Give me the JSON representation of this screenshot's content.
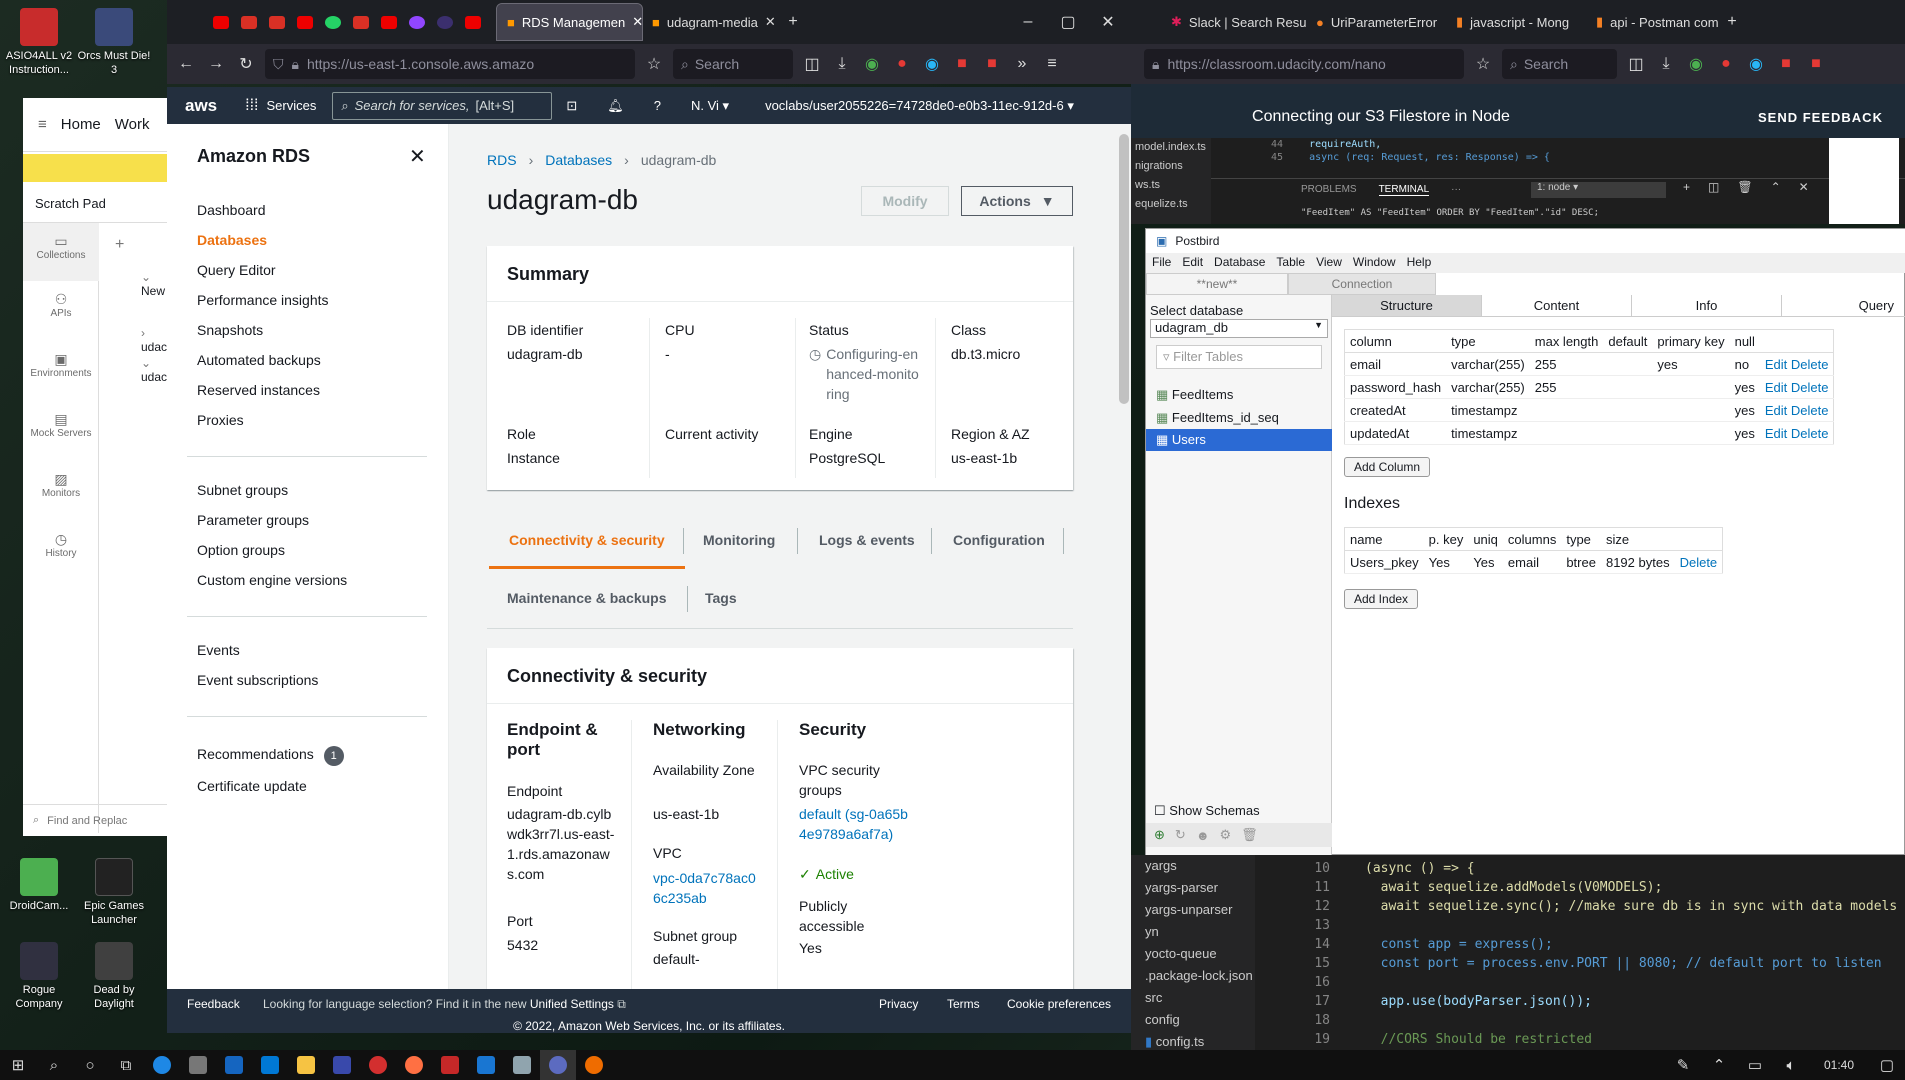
{
  "desktop": {
    "icons": [
      {
        "label": "ASIO4ALL v2 Instruction...",
        "color": "#c82c2c"
      },
      {
        "label": "Orcs Must Die! 3",
        "color": "#3a4a7a"
      },
      {
        "label": "DroidCam...",
        "color": "#4caf50"
      },
      {
        "label": "Epic Games Launcher",
        "color": "#222222"
      },
      {
        "label": "Rogue Company",
        "color": "#303040"
      },
      {
        "label": "Dead by Daylight",
        "color": "#404040"
      }
    ]
  },
  "browser_left": {
    "tabs": [
      {
        "label": "RDS Managemen",
        "active": true
      },
      {
        "label": "udagram-media",
        "active": false
      }
    ],
    "url": "https://us-east-1.console.aws.amazo",
    "search_placeholder": "Search"
  },
  "browser_right": {
    "tabs": [
      {
        "label": "Slack | Search Resu"
      },
      {
        "label": "UriParameterError"
      },
      {
        "label": "javascript - Mong"
      },
      {
        "label": "api - Postman com"
      }
    ],
    "url": "https://classroom.udacity.com/nano",
    "search_placeholder": "Search"
  },
  "aws": {
    "logo": "aws",
    "services": "Services",
    "search_placeholder": "Search for services,",
    "search_shortcut": "[Alt+S]",
    "region": "N. Vi",
    "account": "voclabs/user2055226=74728de0-e0b3-11ec-912d-6"
  },
  "rds_sidebar": {
    "title": "Amazon RDS",
    "items": [
      "Dashboard",
      "Databases",
      "Query Editor",
      "Performance insights",
      "Snapshots",
      "Automated backups",
      "Reserved instances",
      "Proxies"
    ],
    "items2": [
      "Subnet groups",
      "Parameter groups",
      "Option groups",
      "Custom engine versions"
    ],
    "items3": [
      "Events",
      "Event subscriptions"
    ],
    "items4": [
      "Recommendations",
      "Certificate update"
    ],
    "recommendations_badge": "1"
  },
  "rds_main": {
    "breadcrumb": [
      "RDS",
      "Databases",
      "udagram-db"
    ],
    "title": "udagram-db",
    "modify": "Modify",
    "actions": "Actions",
    "summary": {
      "heading": "Summary",
      "db_identifier_label": "DB identifier",
      "db_identifier": "udagram-db",
      "cpu_label": "CPU",
      "cpu": "-",
      "status_label": "Status",
      "status": "Configuring-enhanced-monitoring",
      "class_label": "Class",
      "class": "db.t3.micro",
      "role_label": "Role",
      "role": "Instance",
      "activity_label": "Current activity",
      "engine_label": "Engine",
      "engine": "PostgreSQL",
      "region_label": "Region & AZ",
      "region": "us-east-1b"
    },
    "tabs": [
      "Connectivity & security",
      "Monitoring",
      "Logs & events",
      "Configuration",
      "Maintenance & backups",
      "Tags"
    ],
    "conn": {
      "heading": "Connectivity & security",
      "endpoint_heading": "Endpoint & port",
      "endpoint_label": "Endpoint",
      "endpoint": "udagram-db.cylbwdk3rr7l.us-east-1.rds.amazonaws.com",
      "port_label": "Port",
      "port": "5432",
      "networking_heading": "Networking",
      "az_label": "Availability Zone",
      "az": "us-east-1b",
      "vpc_label": "VPC",
      "vpc": "vpc-0da7c78ac06c235ab",
      "subnet_label": "Subnet group",
      "subnet": "default-",
      "security_heading": "Security",
      "sg_label": "VPC security groups",
      "sg": "default (sg-0a65b4e9789a6af7a)",
      "sg_status": "Active",
      "public_label": "Publicly accessible",
      "public": "Yes"
    }
  },
  "aws_footer": {
    "feedback": "Feedback",
    "lang_msg": "Looking for language selection? Find it in the new",
    "unified": "Unified Settings",
    "privacy": "Privacy",
    "terms": "Terms",
    "cookies": "Cookie preferences",
    "copyright": "© 2022, Amazon Web Services, Inc. or its affiliates."
  },
  "udacity": {
    "header": "Connecting our S3 Filestore in Node",
    "feedback": "SEND FEEDBACK"
  },
  "vscode_top": {
    "files": [
      "model.index.ts",
      "nigrations",
      "ws.ts",
      "equelize.ts"
    ],
    "lines": [
      {
        "n": "44",
        "t": "requireAuth,"
      },
      {
        "n": "45",
        "t": "async (req: Request, res: Response) => {"
      }
    ],
    "panel_tabs": [
      "PROBLEMS",
      "TERMINAL",
      "···"
    ],
    "terminal_select": "1: node",
    "terminal_text": "\"FeedItem\" AS \"FeedItem\" ORDER BY \"FeedItem\".\"id\" DESC;"
  },
  "postbird": {
    "title": "Postbird",
    "menu": [
      "File",
      "Edit",
      "Database",
      "Table",
      "View",
      "Window",
      "Help"
    ],
    "tabs": [
      "**new**",
      "Connection"
    ],
    "subtabs": [
      "Structure",
      "Content",
      "Info",
      "Query"
    ],
    "select_db_label": "Select database",
    "db": "udagram_db",
    "filter_placeholder": "Filter Tables",
    "tables": [
      "FeedItems",
      "FeedItems_id_seq",
      "Users"
    ],
    "show_schemas": "Show Schemas",
    "columns_headers": [
      "column",
      "type",
      "max length",
      "default",
      "primary key",
      "null",
      ""
    ],
    "columns": [
      [
        "email",
        "varchar(255)",
        "255",
        "",
        "yes",
        "no"
      ],
      [
        "password_hash",
        "varchar(255)",
        "255",
        "",
        "",
        "yes"
      ],
      [
        "createdAt",
        "timestampz",
        "",
        "",
        "",
        "yes"
      ],
      [
        "updatedAt",
        "timestampz",
        "",
        "",
        "",
        "yes"
      ]
    ],
    "edit": "Edit",
    "delete": "Delete",
    "add_column": "Add Column",
    "indexes_heading": "Indexes",
    "index_headers": [
      "name",
      "p. key",
      "uniq",
      "columns",
      "type",
      "size",
      ""
    ],
    "indexes": [
      [
        "Users_pkey",
        "Yes",
        "Yes",
        "email",
        "btree",
        "8192 bytes"
      ]
    ],
    "add_index": "Add Index"
  },
  "vscode_bottom": {
    "explorer": [
      "yargs",
      "yargs-parser",
      "yargs-unparser",
      "yn",
      "yocto-queue",
      ".package-lock.json",
      "src",
      "config",
      "config.ts"
    ],
    "code": [
      {
        "n": "10",
        "t": "(async () => {"
      },
      {
        "n": "11",
        "t": "  await sequelize.addModels(V0MODELS);"
      },
      {
        "n": "12",
        "t": "  await sequelize.sync(); //make sure db is in sync with data models"
      },
      {
        "n": "13",
        "t": ""
      },
      {
        "n": "14",
        "t": "  const app = express();"
      },
      {
        "n": "15",
        "t": "  const port = process.env.PORT || 8080; // default port to listen"
      },
      {
        "n": "16",
        "t": ""
      },
      {
        "n": "17",
        "t": "  app.use(bodyParser.json());"
      },
      {
        "n": "18",
        "t": ""
      },
      {
        "n": "19",
        "t": "  //CORS Should be restricted"
      }
    ]
  },
  "postman": {
    "home": "Home",
    "work": "Work",
    "scratch": "Scratch Pad",
    "nav": [
      "Collections",
      "APIs",
      "Environments",
      "Mock Servers",
      "Monitors",
      "History"
    ],
    "tree": [
      "New",
      "udac",
      "udac"
    ],
    "find": "Find and Replac"
  },
  "taskbar": {
    "time": "01:40"
  }
}
